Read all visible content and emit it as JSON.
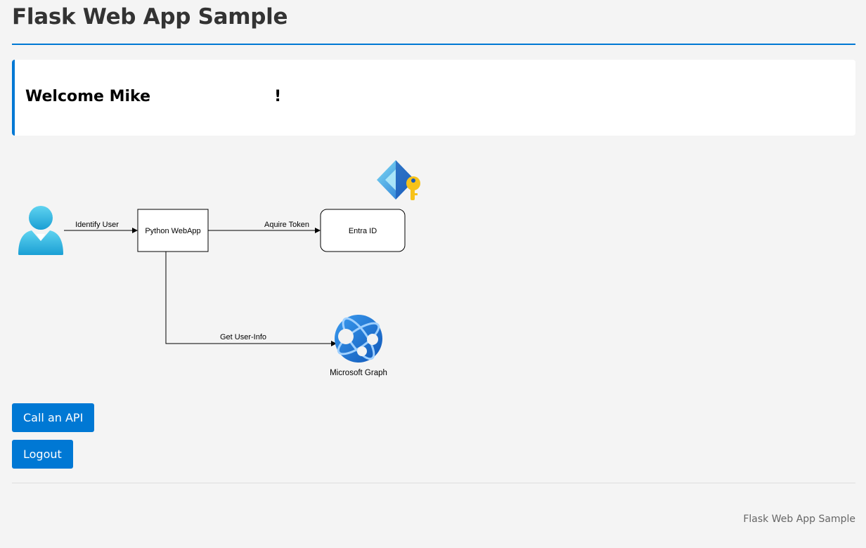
{
  "header": {
    "title": "Flask Web App Sample"
  },
  "welcome": {
    "text": "Welcome Mike                       !"
  },
  "diagram": {
    "nodes": {
      "webapp": "Python WebApp",
      "entra": "Entra ID",
      "graph": "Microsoft Graph"
    },
    "edges": {
      "identify": "Identify User",
      "acquire": "Aquire Token",
      "userinfo": "Get User-Info"
    },
    "icons": {
      "user": "user-icon",
      "entra": "entra-id-key-icon",
      "graph": "microsoft-graph-icon"
    }
  },
  "actions": {
    "call_api": "Call an API",
    "logout": "Logout"
  },
  "footer": {
    "text": "Flask Web App Sample"
  },
  "colors": {
    "accent": "#0078d4",
    "background": "#f4f4f4",
    "card": "#ffffff"
  }
}
